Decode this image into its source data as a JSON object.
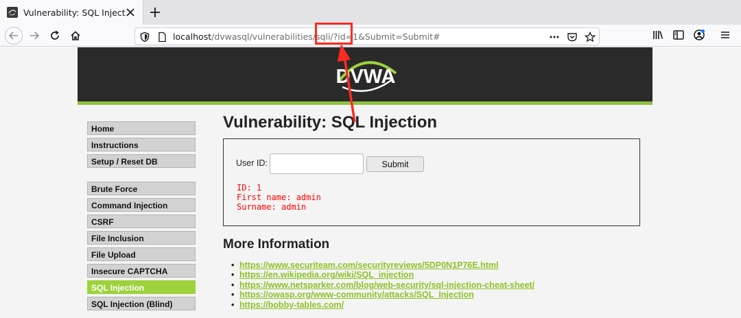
{
  "browser": {
    "tab_title": "Vulnerability: SQL Injection ::",
    "url_host": "localhost",
    "url_path": "/dvwasql/vulnerabilities/sqli/?id=1&Submit=Submit#"
  },
  "header": {
    "logo_text": "DVWA"
  },
  "menu": {
    "items": [
      {
        "label": "Home"
      },
      {
        "label": "Instructions"
      },
      {
        "label": "Setup / Reset DB"
      },
      {
        "label": "Brute Force"
      },
      {
        "label": "Command Injection"
      },
      {
        "label": "CSRF"
      },
      {
        "label": "File Inclusion"
      },
      {
        "label": "File Upload"
      },
      {
        "label": "Insecure CAPTCHA"
      },
      {
        "label": "SQL Injection"
      },
      {
        "label": "SQL Injection (Blind)"
      }
    ]
  },
  "main": {
    "title": "Vulnerability: SQL Injection",
    "user_id_label": "User ID:",
    "user_id_value": "",
    "submit_label": "Submit",
    "result": {
      "id_line": "ID: 1",
      "first_name_line": "First name: admin",
      "surname_line": "Surname: admin"
    },
    "more_info_title": "More Information",
    "links": [
      "https://www.securiteam.com/securityreviews/5DP0N1P76E.html",
      "https://en.wikipedia.org/wiki/SQL_injection",
      "https://www.netsparker.com/blog/web-security/sql-injection-cheat-sheet/",
      "https://owasp.org/www-community/attacks/SQL_Injection",
      "https://bobby-tables.com/"
    ]
  },
  "colors": {
    "accent_green": "#8fc13e",
    "active_menu": "#9ed23c",
    "result_red": "#ff0000",
    "annotation_red": "#ff2b1f"
  }
}
